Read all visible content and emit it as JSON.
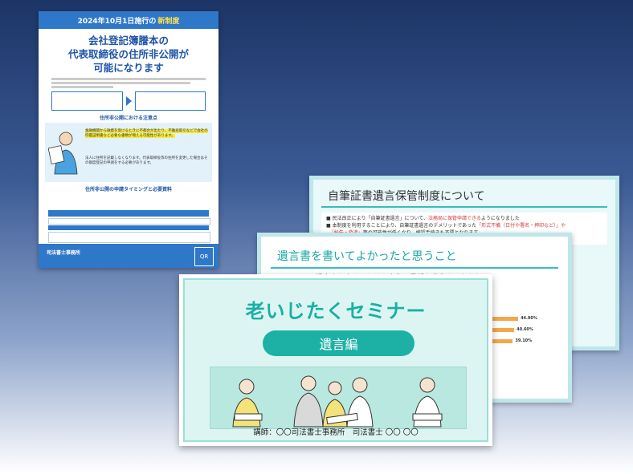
{
  "flyer": {
    "top_banner_prefix": "2024年10月1日施行の",
    "top_banner_highlight": "新制度",
    "title_line1": "会社登記簿謄本の",
    "title_line2": "代表取締役の住所非公開が",
    "title_line3": "可能になります",
    "section1": "住所非公開における注意点",
    "note1": "金融機関から融資を受けるときに不都合が出たり、不動産取引などで会社の印鑑証明書など必要な書類が増える可能性があります。",
    "note2": "法人に住所を記載しなくなります。代表取締役等の住所を変更した場合はその都度登記の申請をする必要があります。",
    "section2": "住所非公開の申請タイミングと必要資料",
    "office": "司法書士事務所",
    "qr": "QR"
  },
  "slide_back": {
    "title": "自筆証書遺言保管制度について",
    "line1_a": "民法改正により「自筆証書遺言」について、",
    "line1_red": "法務局に保管申請できる",
    "line1_b": "ようになりました",
    "line2_a": "本制度を利用することにより、自筆証書遺言のデメリットであった",
    "line2_red": "「形式不備（日付や署名・押印など）」や",
    "line3_red": "「紛失・偽造」",
    "line3_b": "等の可能性が低くなり、検認手続きも不要となります"
  },
  "slide_mid": {
    "title": "遺言書を書いてよかったと思うこと",
    "text": "遺言書を書くことは、人生の最期を迎えるにあたり、",
    "bar_labels": [
      "44.90%",
      "40.60%",
      "39.10%"
    ]
  },
  "chart_data": {
    "type": "bar",
    "values": [
      44.9,
      40.6,
      39.1
    ],
    "labels": [
      "44.90%",
      "40.60%",
      "39.10%"
    ],
    "xlim": [
      0,
      50
    ]
  },
  "slide_front": {
    "title": "老いじたくセミナー",
    "subtitle": "遺言編",
    "caption": "講師：〇〇司法書士事務所　司法書士 〇〇 〇〇"
  },
  "colors": {
    "teal": "#1db1a6",
    "blue": "#2f77c9",
    "orange": "#f2a84a"
  }
}
